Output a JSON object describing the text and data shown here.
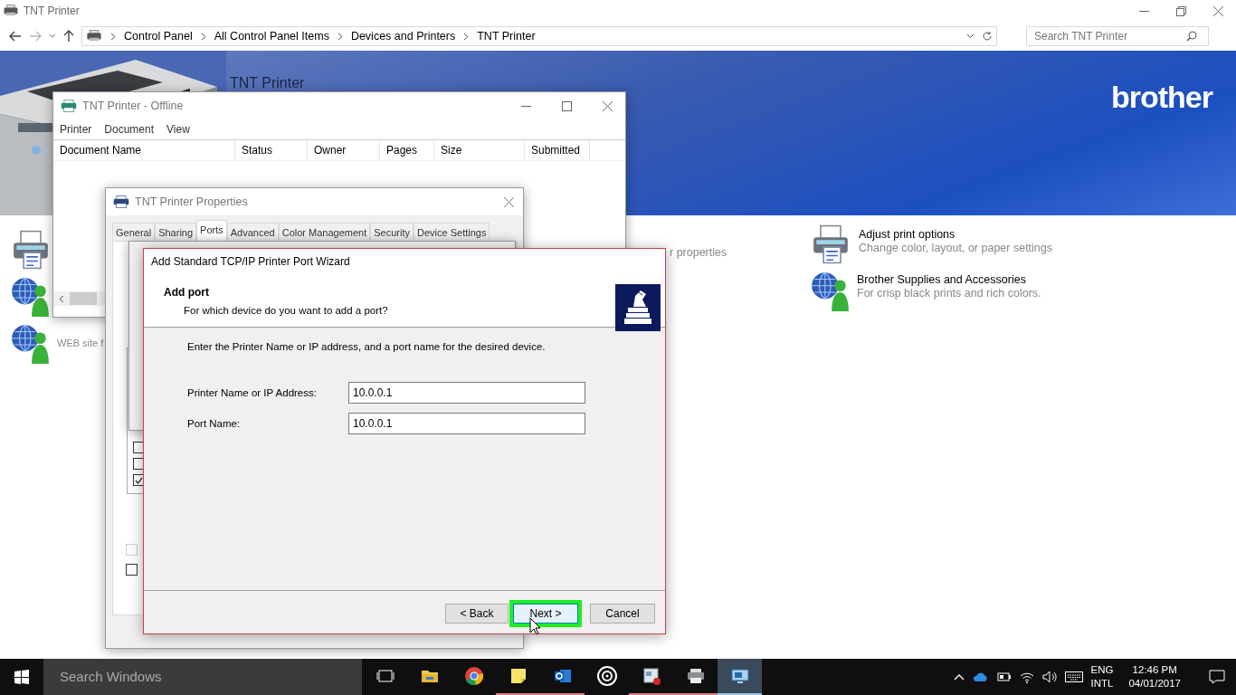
{
  "explorer": {
    "title": "TNT Printer",
    "breadcrumb": [
      "Control Panel",
      "All Control Panel Items",
      "Devices and Printers",
      "TNT Printer"
    ],
    "search": {
      "placeholder": "Search TNT Printer"
    },
    "banner": {
      "title": "TNT Printer",
      "logo": "brother"
    },
    "left_tasks": [
      {
        "kind": "printer"
      },
      {
        "kind": "globe"
      },
      {
        "kind": "globe",
        "label": "WEB site f"
      }
    ],
    "middle_fragment": "r properties",
    "right_tasks": [
      {
        "kind": "printer",
        "title": "Adjust print options",
        "subtitle": "Change color, layout, or paper settings"
      },
      {
        "kind": "globe",
        "title": "Brother Supplies and Accessories",
        "subtitle": "For crisp black prints and rich colors."
      }
    ]
  },
  "print_queue": {
    "title": "TNT Printer - Offline",
    "menu": [
      "Printer",
      "Document",
      "View"
    ],
    "columns": [
      "Document Name",
      "Status",
      "Owner",
      "Pages",
      "Size",
      "Submitted"
    ]
  },
  "properties": {
    "title": "TNT Printer Properties",
    "tabs": [
      {
        "label": "General",
        "selected": false
      },
      {
        "label": "Sharing",
        "selected": false
      },
      {
        "label": "Ports",
        "selected": true
      },
      {
        "label": "Advanced",
        "selected": false
      },
      {
        "label": "Color Management",
        "selected": false
      },
      {
        "label": "Security",
        "selected": false
      },
      {
        "label": "Device Settings",
        "selected": false
      }
    ],
    "port_checks": [
      {
        "checked": false
      },
      {
        "checked": false
      },
      {
        "checked": true
      }
    ],
    "option_checks": [
      {
        "checked": false,
        "disabled": true
      },
      {
        "checked": false,
        "disabled": false
      }
    ]
  },
  "wizard": {
    "title": "Add Standard TCP/IP Printer Port Wizard",
    "heading": "Add port",
    "subheading": "For which device do you want to add a port?",
    "instruction": "Enter the Printer Name or IP address, and a port name for the desired device.",
    "fields": [
      {
        "label": "Printer Name or IP Address:",
        "value": "10.0.0.1"
      },
      {
        "label": "Port Name:",
        "value": "10.0.0.1"
      }
    ],
    "buttons": [
      {
        "label": "< Back",
        "highlighted": false
      },
      {
        "label": "Next >",
        "highlighted": true
      },
      {
        "label": "Cancel",
        "highlighted": false
      }
    ]
  },
  "taskbar": {
    "search": {
      "placeholder": "Search Windows"
    },
    "apps": [
      {
        "kind": "task-view",
        "running": false,
        "selected": false
      },
      {
        "kind": "folder",
        "running": false,
        "selected": false
      },
      {
        "kind": "browser",
        "running": false,
        "selected": false
      },
      {
        "kind": "note",
        "running": true,
        "selected": false
      },
      {
        "kind": "mail",
        "running": true,
        "selected": false
      },
      {
        "kind": "disc",
        "running": false,
        "selected": false
      },
      {
        "kind": "window",
        "running": true,
        "selected": false
      },
      {
        "kind": "printer",
        "running": true,
        "selected": false
      },
      {
        "kind": "monitor",
        "running": true,
        "selected": true
      }
    ],
    "language": "ENG",
    "layout": "INTL",
    "time": "12:46 PM",
    "date": "04/01/2017"
  }
}
